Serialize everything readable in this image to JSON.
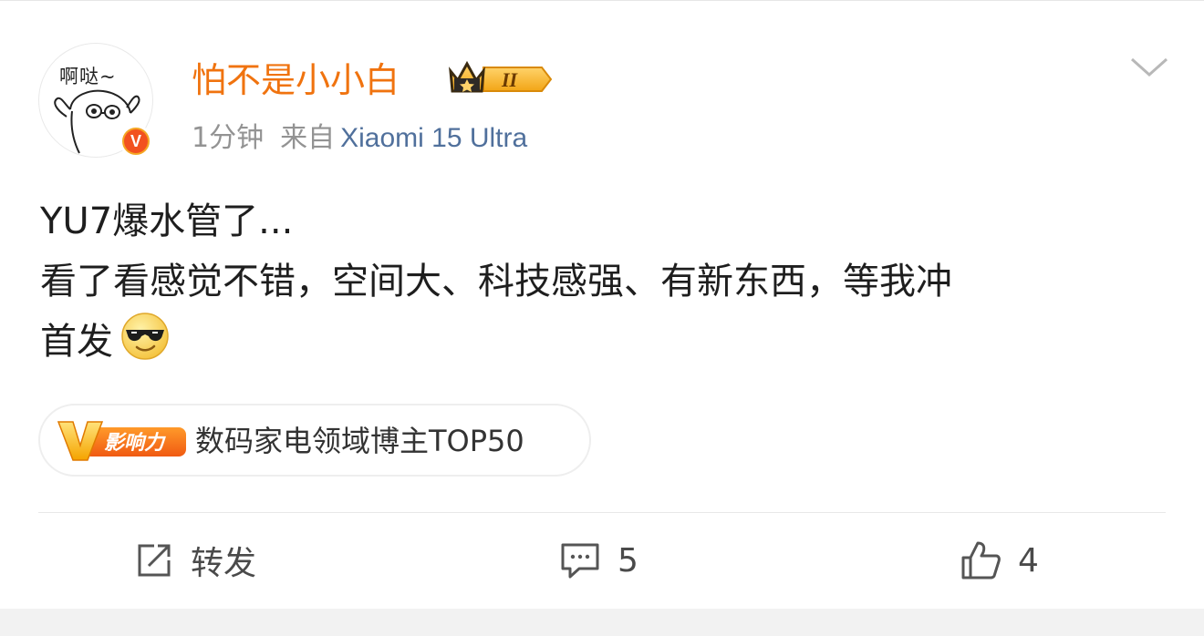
{
  "post": {
    "avatar_text": "啊哒~",
    "username": "怕不是小小白",
    "vip_level": "II",
    "time": "1分钟",
    "source_prefix": "来自",
    "device": "Xiaomi 15 Ultra",
    "text_lines": [
      "YU7爆水管了...",
      "看了看感觉不错，空间大、科技感强、有新东西，等我冲",
      "首发"
    ],
    "influence_tag": {
      "badge_text": "影响力",
      "label": "数码家电领域博主TOP50"
    }
  },
  "actions": {
    "repost_label": "转发",
    "comment_count": "5",
    "like_count": "4"
  },
  "colors": {
    "username": "#f0730f",
    "device_link": "#50709c",
    "meta_gray": "#939393",
    "verified_badge": "#f2511f"
  },
  "icons": [
    "chevron-down-icon",
    "verified-v-icon",
    "vip-crown-icon",
    "sunglasses-emoji-icon",
    "repost-icon",
    "comment-icon",
    "like-icon"
  ]
}
